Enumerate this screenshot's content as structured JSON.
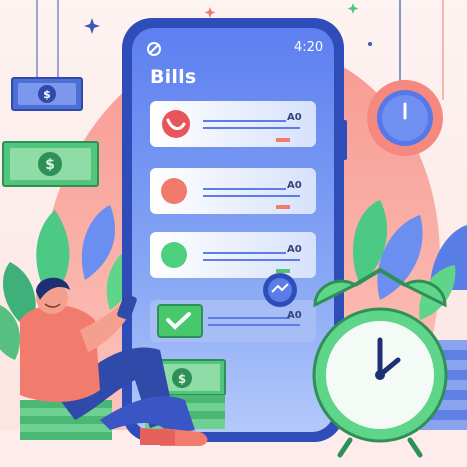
{
  "phone": {
    "title": "Bills",
    "time": "4:20"
  },
  "bills": [
    {
      "amount": "A0",
      "status": "pending",
      "icon": "bill-icon",
      "color": "#e8555a"
    },
    {
      "amount": "A0",
      "status": "pending",
      "icon": "circle-icon",
      "color": "#f27a6c"
    },
    {
      "amount": "A0",
      "status": "paid",
      "icon": "circle-icon",
      "color": "#4cd07d"
    },
    {
      "amount": "A0",
      "status": "done",
      "icon": "checkmark-icon",
      "color": "#47c96b"
    }
  ],
  "colors": {
    "background": "#fce7e4",
    "blob": "#f6a59c",
    "phone_frame": "#2f4db8",
    "phone_screen": "#6e8ff0",
    "money": "#52c57c",
    "clock": "#5fd58a",
    "person_shirt": "#f17b6d",
    "person_pants": "#2f4aa8"
  },
  "icons": [
    "dollar-icon",
    "clock-icon",
    "alarm-clock-icon",
    "settings-gear-icon",
    "sparkle-icon",
    "leaf-icon",
    "checkmark-icon"
  ]
}
